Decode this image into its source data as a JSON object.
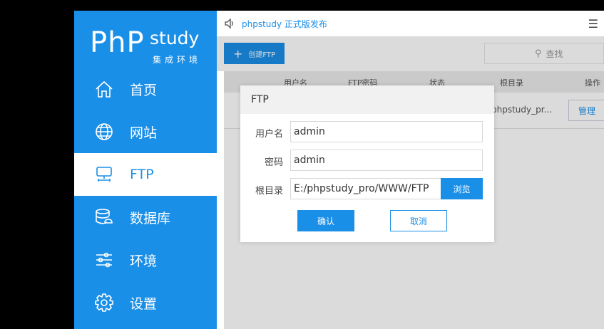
{
  "colors": {
    "brand": "#1a8fe8",
    "overlay": "rgba(0,0,0,0.14)"
  },
  "logo": {
    "php": "PhP",
    "study": "study",
    "sub": "集成环境"
  },
  "sidebar": {
    "items": [
      {
        "label": "首页",
        "icon": "home-icon"
      },
      {
        "label": "网站",
        "icon": "globe-icon"
      },
      {
        "label": "FTP",
        "icon": "ftp-icon",
        "active": true
      },
      {
        "label": "数据库",
        "icon": "database-icon"
      },
      {
        "label": "环境",
        "icon": "sliders-icon"
      },
      {
        "label": "设置",
        "icon": "gear-icon"
      }
    ]
  },
  "topbar": {
    "notice": "phpstudy 正式版发布",
    "menu_icon": "menu-icon",
    "speaker_icon": "speaker-icon"
  },
  "toolbar": {
    "create_label": "创建FTP",
    "search_placeholder": "查找"
  },
  "table": {
    "headers": [
      "用户名",
      "FTP密码",
      "状态",
      "根目录",
      "操作"
    ],
    "rows": [
      {
        "root": "phpstudy_pr...",
        "action": "管理"
      }
    ]
  },
  "dialog": {
    "title": "FTP",
    "username_label": "用户名",
    "username_value": "admin",
    "password_label": "密码",
    "password_value": "admin",
    "root_label": "根目录",
    "root_value": "E:/phpstudy_pro/WWW/FTP",
    "browse_label": "浏览",
    "ok_label": "确认",
    "cancel_label": "取消"
  }
}
